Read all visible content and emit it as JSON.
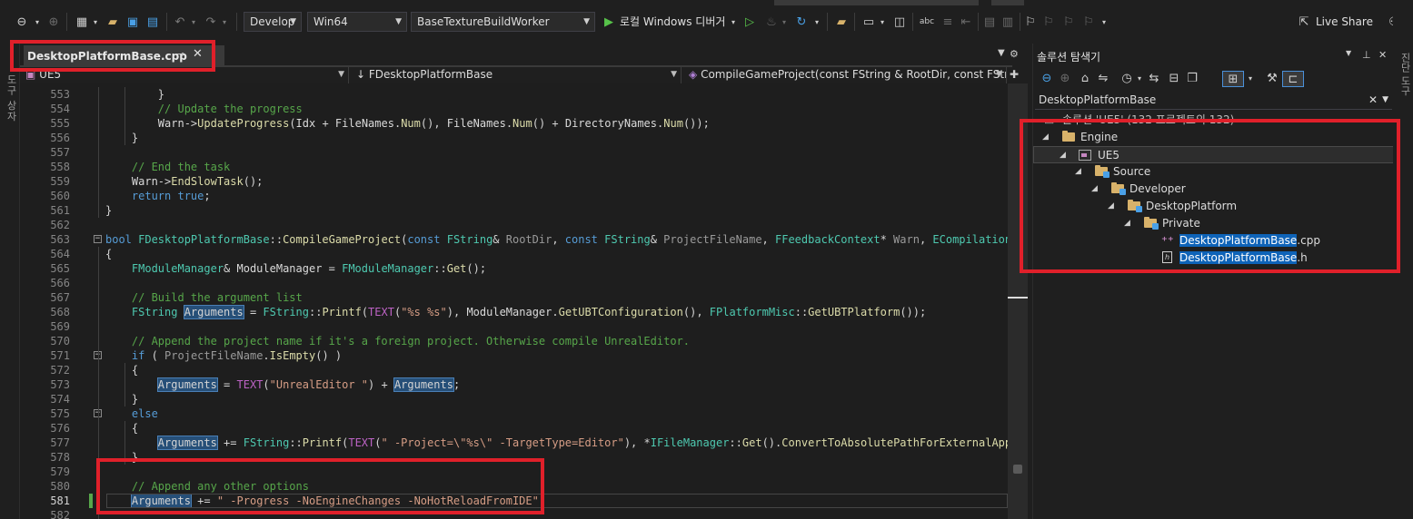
{
  "toolbar": {
    "configuration": "Develop",
    "platform": "Win64",
    "startup_project": "BaseTextureBuildWorker",
    "debugger_label": "로컬 Windows 디버거",
    "live_share_label": "Live Share"
  },
  "left_strip": {
    "label": "도구 상자"
  },
  "right_strip": {
    "label": "진단 도구"
  },
  "editor": {
    "tab_name": "DesktopPlatformBase.cpp",
    "nav_project": "UE5",
    "nav_scope": "FDesktopPlatformBase",
    "nav_member": "CompileGameProject(const FString & RootDir, const FString",
    "current_line": "581",
    "lines": [
      {
        "n": "553",
        "segs": [
          [
            "plain",
            "        }"
          ]
        ]
      },
      {
        "n": "554",
        "segs": [
          [
            "cm",
            "        // Update the progress"
          ]
        ]
      },
      {
        "n": "555",
        "segs": [
          [
            "vr",
            "        Warn"
          ],
          [
            "plain",
            "->"
          ],
          [
            "fn",
            "UpdateProgress"
          ],
          [
            "plain",
            "("
          ],
          [
            "vr",
            "Idx"
          ],
          [
            "plain",
            " + "
          ],
          [
            "vr",
            "FileNames"
          ],
          [
            "plain",
            "."
          ],
          [
            "fn",
            "Num"
          ],
          [
            "plain",
            "(), "
          ],
          [
            "vr",
            "FileNames"
          ],
          [
            "plain",
            "."
          ],
          [
            "fn",
            "Num"
          ],
          [
            "plain",
            "() + "
          ],
          [
            "vr",
            "DirectoryNames"
          ],
          [
            "plain",
            "."
          ],
          [
            "fn",
            "Num"
          ],
          [
            "plain",
            "());"
          ]
        ]
      },
      {
        "n": "556",
        "segs": [
          [
            "plain",
            "    }"
          ]
        ]
      },
      {
        "n": "557",
        "segs": [
          [
            "plain",
            ""
          ]
        ]
      },
      {
        "n": "558",
        "segs": [
          [
            "cm",
            "    // End the task"
          ]
        ]
      },
      {
        "n": "559",
        "segs": [
          [
            "vr",
            "    Warn"
          ],
          [
            "plain",
            "->"
          ],
          [
            "fn",
            "EndSlowTask"
          ],
          [
            "plain",
            "();"
          ]
        ]
      },
      {
        "n": "560",
        "segs": [
          [
            "kw",
            "    return true"
          ],
          [
            "plain",
            ";"
          ]
        ]
      },
      {
        "n": "561",
        "segs": [
          [
            "plain",
            "}"
          ]
        ]
      },
      {
        "n": "562",
        "segs": [
          [
            "plain",
            ""
          ]
        ]
      },
      {
        "n": "563",
        "segs": [
          [
            "kw",
            "bool "
          ],
          [
            "ty",
            "FDesktopPlatformBase"
          ],
          [
            "plain",
            "::"
          ],
          [
            "fn",
            "CompileGameProject"
          ],
          [
            "plain",
            "("
          ],
          [
            "kw",
            "const "
          ],
          [
            "ty",
            "FString"
          ],
          [
            "plain",
            "& "
          ],
          [
            "pa",
            "RootDir"
          ],
          [
            "plain",
            ", "
          ],
          [
            "kw",
            "const "
          ],
          [
            "ty",
            "FString"
          ],
          [
            "plain",
            "& "
          ],
          [
            "pa",
            "ProjectFileName"
          ],
          [
            "plain",
            ", "
          ],
          [
            "ty",
            "FFeedbackContext"
          ],
          [
            "plain",
            "* "
          ],
          [
            "pa",
            "Warn"
          ],
          [
            "plain",
            ", "
          ],
          [
            "ty",
            "ECompilationResu"
          ]
        ]
      },
      {
        "n": "564",
        "segs": [
          [
            "plain",
            "{"
          ]
        ]
      },
      {
        "n": "565",
        "segs": [
          [
            "ty",
            "    FModuleManager"
          ],
          [
            "plain",
            "& "
          ],
          [
            "vr",
            "ModuleManager"
          ],
          [
            "plain",
            " = "
          ],
          [
            "ty",
            "FModuleManager"
          ],
          [
            "plain",
            "::"
          ],
          [
            "fn",
            "Get"
          ],
          [
            "plain",
            "();"
          ]
        ]
      },
      {
        "n": "566",
        "segs": [
          [
            "plain",
            ""
          ]
        ]
      },
      {
        "n": "567",
        "segs": [
          [
            "cm",
            "    // Build the argument list"
          ]
        ]
      },
      {
        "n": "568",
        "segs": [
          [
            "ty",
            "    FString "
          ],
          [
            "hl",
            "Arguments"
          ],
          [
            "plain",
            " = "
          ],
          [
            "ty",
            "FString"
          ],
          [
            "plain",
            "::"
          ],
          [
            "fn",
            "Printf"
          ],
          [
            "plain",
            "("
          ],
          [
            "mac",
            "TEXT"
          ],
          [
            "plain",
            "("
          ],
          [
            "st",
            "\"%s %s\""
          ],
          [
            "plain",
            "), "
          ],
          [
            "vr",
            "ModuleManager"
          ],
          [
            "plain",
            "."
          ],
          [
            "fn",
            "GetUBTConfiguration"
          ],
          [
            "plain",
            "(), "
          ],
          [
            "ty",
            "FPlatformMisc"
          ],
          [
            "plain",
            "::"
          ],
          [
            "fn",
            "GetUBTPlatform"
          ],
          [
            "plain",
            "());"
          ]
        ]
      },
      {
        "n": "569",
        "segs": [
          [
            "plain",
            ""
          ]
        ]
      },
      {
        "n": "570",
        "segs": [
          [
            "cm",
            "    // Append the project name if it's a foreign project. Otherwise compile UnrealEditor."
          ]
        ]
      },
      {
        "n": "571",
        "segs": [
          [
            "kw",
            "    if"
          ],
          [
            "plain",
            " ( "
          ],
          [
            "pa",
            "ProjectFileName"
          ],
          [
            "plain",
            "."
          ],
          [
            "fn",
            "IsEmpty"
          ],
          [
            "plain",
            "() )"
          ]
        ]
      },
      {
        "n": "572",
        "segs": [
          [
            "plain",
            "    {"
          ]
        ]
      },
      {
        "n": "573",
        "segs": [
          [
            "plain",
            "        "
          ],
          [
            "hl",
            "Arguments"
          ],
          [
            "plain",
            " = "
          ],
          [
            "mac",
            "TEXT"
          ],
          [
            "plain",
            "("
          ],
          [
            "st",
            "\"UnrealEditor \""
          ],
          [
            "plain",
            ") + "
          ],
          [
            "hl",
            "Arguments"
          ],
          [
            "plain",
            ";"
          ]
        ]
      },
      {
        "n": "574",
        "segs": [
          [
            "plain",
            "    }"
          ]
        ]
      },
      {
        "n": "575",
        "segs": [
          [
            "kw",
            "    else"
          ]
        ]
      },
      {
        "n": "576",
        "segs": [
          [
            "plain",
            "    {"
          ]
        ]
      },
      {
        "n": "577",
        "segs": [
          [
            "plain",
            "        "
          ],
          [
            "hl",
            "Arguments"
          ],
          [
            "plain",
            " += "
          ],
          [
            "ty",
            "FString"
          ],
          [
            "plain",
            "::"
          ],
          [
            "fn",
            "Printf"
          ],
          [
            "plain",
            "("
          ],
          [
            "mac",
            "TEXT"
          ],
          [
            "plain",
            "("
          ],
          [
            "st",
            "\" -Project=\\\"%s\\\" -TargetType=Editor\""
          ],
          [
            "plain",
            "), *"
          ],
          [
            "ty",
            "IFileManager"
          ],
          [
            "plain",
            "::"
          ],
          [
            "fn",
            "Get"
          ],
          [
            "plain",
            "()."
          ],
          [
            "fn",
            "ConvertToAbsolutePathForExternalAppForR"
          ]
        ]
      },
      {
        "n": "578",
        "segs": [
          [
            "plain",
            "    }"
          ]
        ]
      },
      {
        "n": "579",
        "segs": [
          [
            "plain",
            ""
          ]
        ]
      },
      {
        "n": "580",
        "segs": [
          [
            "cm",
            "    // Append any other options"
          ]
        ]
      },
      {
        "n": "581",
        "segs": [
          [
            "plain",
            "    "
          ],
          [
            "hl",
            "Arguments"
          ],
          [
            "plain",
            " += "
          ],
          [
            "st",
            "\" -Progress -NoEngineChanges -NoHotReloadFromIDE\""
          ],
          [
            "plain",
            ";"
          ]
        ]
      },
      {
        "n": "582",
        "segs": [
          [
            "plain",
            ""
          ]
        ]
      }
    ]
  },
  "solution_explorer": {
    "title": "솔루션 탐색기",
    "search_value": "DesktopPlatformBase",
    "tree": [
      {
        "label": "솔루션 'UE5' (132 프로젝트의 132)",
        "level": 0,
        "icon": "solution-icon",
        "expander": ""
      },
      {
        "label": "Engine",
        "level": 0,
        "icon": "folder-icon",
        "expander": "◢"
      },
      {
        "label": "UE5",
        "level": 1,
        "icon": "cpp-project-icon",
        "expander": "◢"
      },
      {
        "label": "Source",
        "level": 2,
        "icon": "filter-folder-icon",
        "expander": "◢"
      },
      {
        "label": "Developer",
        "level": 3,
        "icon": "filter-folder-icon",
        "expander": "◢"
      },
      {
        "label": "DesktopPlatform",
        "level": 4,
        "icon": "filter-folder-icon",
        "expander": "◢"
      },
      {
        "label": "Private",
        "level": 5,
        "icon": "filter-folder-icon",
        "expander": "◢"
      },
      {
        "label_match": "DesktopPlatformBase",
        "label_rest": ".cpp",
        "level": 6,
        "icon": "cpp-file-icon",
        "expander": ""
      },
      {
        "label_match": "DesktopPlatformBase",
        "label_rest": ".h",
        "level": 6,
        "icon": "header-file-icon",
        "expander": ""
      }
    ]
  },
  "colors": {
    "highlight_box": "#e0202a",
    "selection": "#0e63b8",
    "comment": "#57a64a",
    "keyword": "#569cd6",
    "type": "#4ec9b0",
    "function": "#dcdcaa",
    "string": "#d69d85"
  }
}
